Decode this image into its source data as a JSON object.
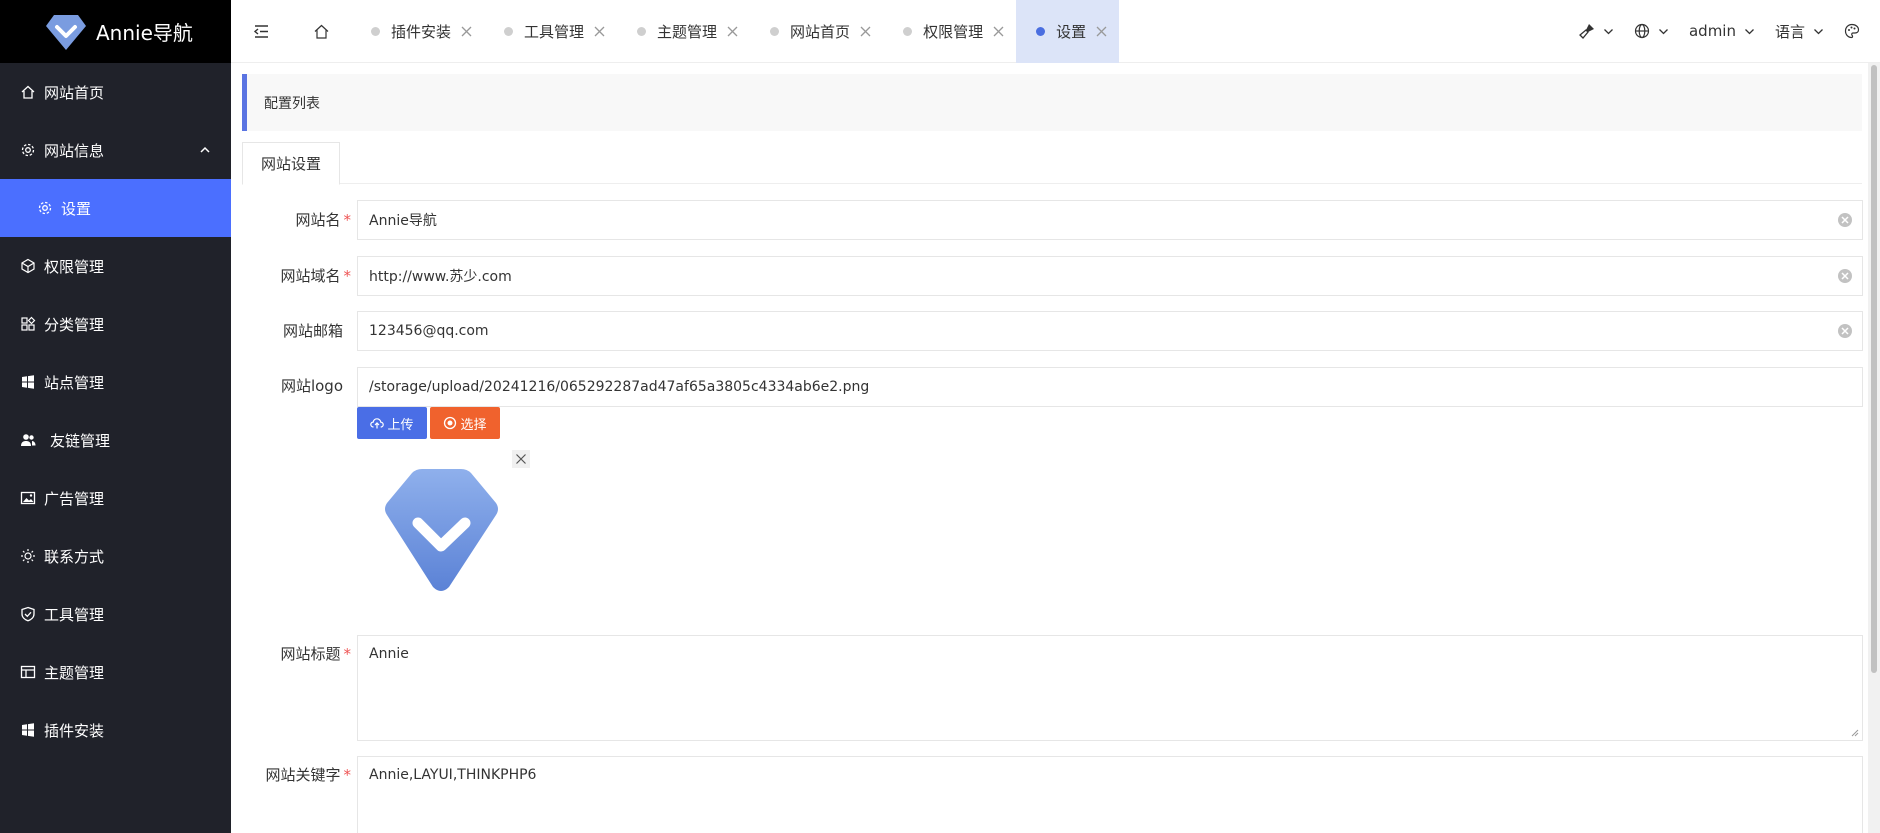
{
  "app": {
    "logo_text": "Annie导航"
  },
  "sidebar": {
    "items": [
      {
        "label": "网站首页",
        "icon": "home-icon"
      },
      {
        "label": "网站信息",
        "icon": "gear-icon"
      },
      {
        "label": "设置",
        "icon": "gear-icon"
      },
      {
        "label": "权限管理",
        "icon": "cube-icon"
      },
      {
        "label": "分类管理",
        "icon": "apps-icon"
      },
      {
        "label": "站点管理",
        "icon": "windows-icon"
      },
      {
        "label": "友链管理",
        "icon": "users-icon"
      },
      {
        "label": "广告管理",
        "icon": "image-icon"
      },
      {
        "label": "联系方式",
        "icon": "sun-icon"
      },
      {
        "label": "工具管理",
        "icon": "shield-icon"
      },
      {
        "label": "主题管理",
        "icon": "layout-icon"
      },
      {
        "label": "插件安装",
        "icon": "windows-icon"
      }
    ]
  },
  "topbar": {
    "tabs": [
      {
        "label": "插件安装"
      },
      {
        "label": "工具管理"
      },
      {
        "label": "主题管理"
      },
      {
        "label": "网站首页"
      },
      {
        "label": "权限管理"
      },
      {
        "label": "设置"
      }
    ],
    "user": "admin",
    "language": "语言"
  },
  "panel": {
    "title": "配置列表",
    "tab": "网站设置"
  },
  "form": {
    "site_name": {
      "label": "网站名",
      "value": "Annie导航"
    },
    "site_domain": {
      "label": "网站域名",
      "value": "http://www.苏少.com"
    },
    "site_email": {
      "label": "网站邮箱",
      "value": "123456@qq.com"
    },
    "site_logo": {
      "label": "网站logo",
      "value": "/storage/upload/20241216/065292287ad47af65a3805c4334ab6e2.png",
      "upload_label": "上传",
      "select_label": "选择"
    },
    "site_title": {
      "label": "网站标题",
      "value": "Annie"
    },
    "site_keywords": {
      "label": "网站关键字",
      "value": "Annie,LAYUI,THINKPHP6"
    }
  },
  "colors": {
    "accent": "#4b6fff",
    "sidebar": "#20222a",
    "select_btn": "#f0622d"
  }
}
